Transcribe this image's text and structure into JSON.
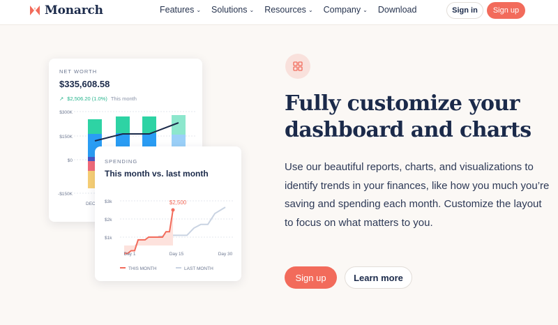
{
  "nav": {
    "brand": "Monarch",
    "items": [
      {
        "label": "Features",
        "dropdown": true
      },
      {
        "label": "Solutions",
        "dropdown": true
      },
      {
        "label": "Resources",
        "dropdown": true
      },
      {
        "label": "Company",
        "dropdown": true
      },
      {
        "label": "Download",
        "dropdown": false
      }
    ],
    "signin_label": "Sign in",
    "signup_label": "Sign up"
  },
  "net_worth_card": {
    "label": "NET WORTH",
    "value": "$335,608.58",
    "change_value": "$2,506.20 (1.0%)",
    "change_period": "This month",
    "y_ticks": [
      "$300K",
      "$150K",
      "$0",
      "-$150K"
    ],
    "x_tick_visible": "DEC"
  },
  "spending_card": {
    "label": "SPENDING",
    "title": "This month vs. last month",
    "y_ticks": [
      "$3k",
      "$2k",
      "$1k"
    ],
    "x_ticks": [
      "Day 1",
      "Day 15",
      "Day 30"
    ],
    "annotation": "$2,500",
    "legend": [
      "THIS MONTH",
      "LAST MONTH"
    ]
  },
  "hero": {
    "badge_icon": "grid-icon",
    "heading_line1": "Fully customize your",
    "heading_line2": "dashboard and charts",
    "body": "Use our beautiful reports, charts, and visualizations to identify trends in your finances, like how you much you’re saving and spending each month. Customize the layout to focus on what matters to you.",
    "primary_cta": "Sign up",
    "secondary_cta": "Learn more"
  },
  "colors": {
    "accent": "#f26b5b",
    "navy": "#1b2a4a",
    "teal": "#2ed3a4",
    "blue": "#2a9df4",
    "green_up": "#25b48c",
    "last_month_line": "#c9d3e2"
  },
  "chart_data": [
    {
      "type": "bar",
      "title": "NET WORTH",
      "categories": [
        "",
        "",
        "",
        "DEC"
      ],
      "series": [],
      "line_values_k": [
        35,
        80,
        80,
        138
      ],
      "ylim": [
        -150000,
        300000
      ],
      "ytick_labels": [
        "$300K",
        "$150K",
        "$0",
        "-$150K"
      ]
    },
    {
      "type": "line",
      "title": "This month vs. last month",
      "xlabel": "",
      "ylabel": "",
      "ylim": [
        0,
        3500
      ],
      "x_ticks": [
        "Day 1",
        "Day 15",
        "Day 30"
      ],
      "series": [
        {
          "name": "THIS MONTH",
          "x": [
            1,
            2,
            3,
            4,
            5,
            6,
            7,
            8,
            9,
            10,
            11,
            12,
            13,
            14,
            15
          ],
          "values": [
            100,
            100,
            250,
            250,
            850,
            850,
            850,
            1000,
            1000,
            1000,
            1000,
            1000,
            1300,
            1300,
            2500
          ]
        },
        {
          "name": "LAST MONTH",
          "x": [
            1,
            3,
            5,
            7,
            9,
            11,
            13,
            15,
            17,
            19,
            21,
            23,
            25,
            27,
            30
          ],
          "values": [
            150,
            350,
            650,
            650,
            650,
            1050,
            1050,
            1100,
            1100,
            1100,
            1500,
            1700,
            1700,
            2300,
            2650
          ]
        }
      ],
      "annotations": [
        "$2,500"
      ]
    }
  ]
}
